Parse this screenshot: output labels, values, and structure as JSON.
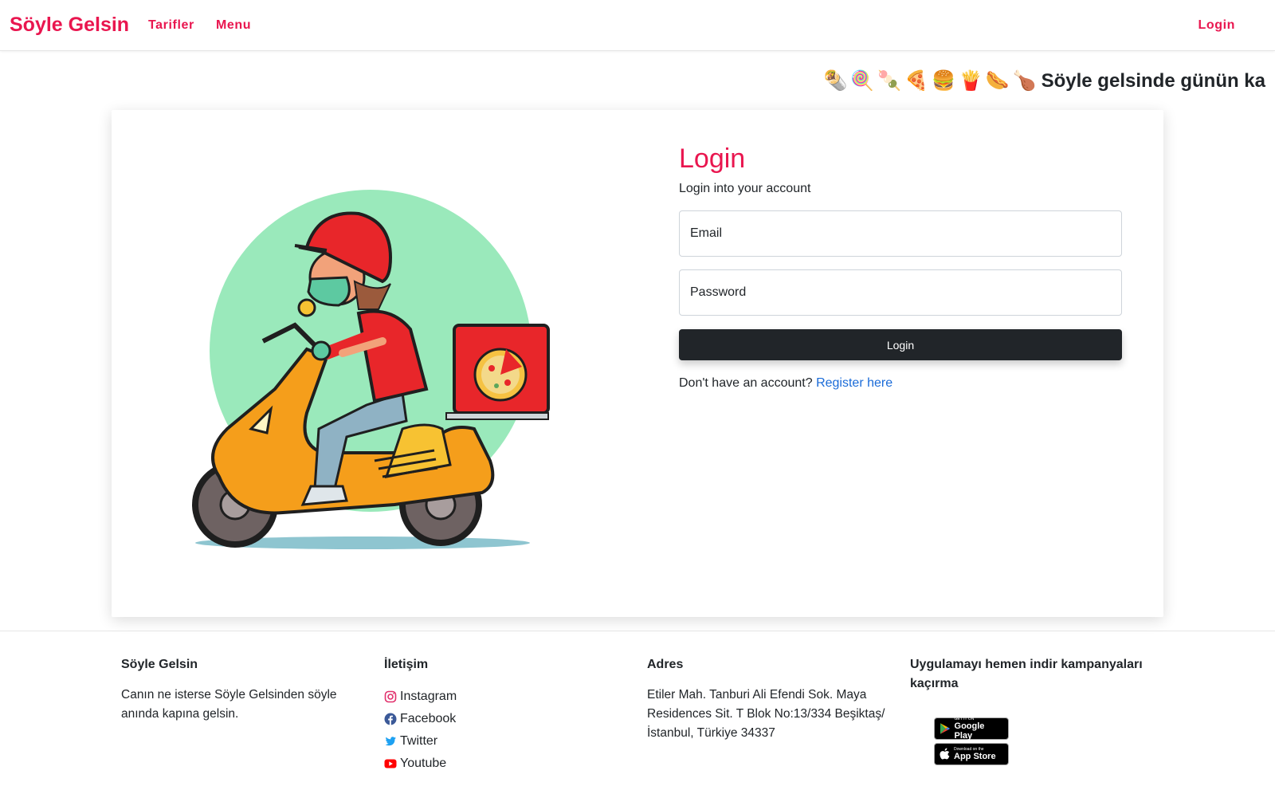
{
  "navbar": {
    "brand": "Söyle Gelsin",
    "links": [
      "Tarifler",
      "Menu"
    ],
    "login": "Login"
  },
  "marquee": {
    "icons": [
      "🌯",
      "🍭",
      "🍡",
      "🍕",
      "🍔",
      "🍟",
      "🌭",
      "🍗"
    ],
    "text": "Söyle gelsinde günün ka"
  },
  "login_form": {
    "title": "Login",
    "subtitle": "Login into your account",
    "email_placeholder": "Email",
    "password_placeholder": "Password",
    "button_label": "Login",
    "register_prompt": "Don't have an account?",
    "register_link": "Register here"
  },
  "footer": {
    "about": {
      "title": "Söyle Gelsin",
      "text": "Canın ne isterse Söyle Gelsinden söyle anında kapına gelsin."
    },
    "contact": {
      "title": "İletişim",
      "links": [
        {
          "label": "Instagram",
          "icon": "instagram-icon"
        },
        {
          "label": "Facebook",
          "icon": "facebook-icon"
        },
        {
          "label": "Twitter",
          "icon": "twitter-icon"
        },
        {
          "label": "Youtube",
          "icon": "youtube-icon"
        }
      ]
    },
    "address": {
      "title": "Adres",
      "text": "Etiler Mah. Tanburi Ali Efendi Sok. Maya Residences Sit. T Blok No:13/334 Beşiktaş/İstanbul, Türkiye 34337"
    },
    "app": {
      "title": "Uygulamayı hemen indir kampanyaları kaçırma",
      "google_small": "GET IT ON",
      "google_big": "Google Play",
      "apple_small": "Download on the",
      "apple_big": "App Store"
    }
  },
  "colors": {
    "brand": "#e9164f",
    "dark_button": "#212529",
    "link": "#1a6bd8"
  }
}
